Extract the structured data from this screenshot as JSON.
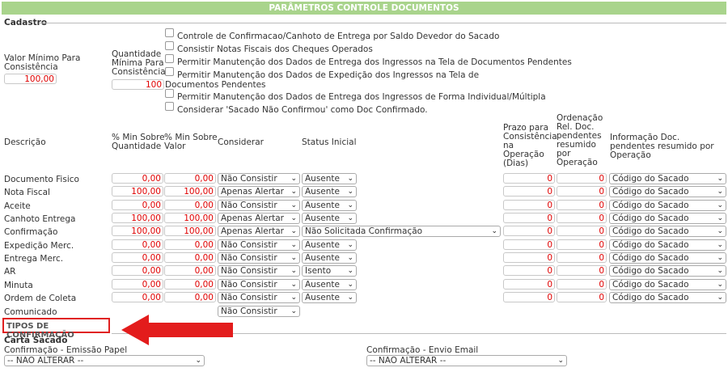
{
  "header": {
    "title": "PARÂMETROS CONTROLE DOCUMENTOS"
  },
  "cadastro": {
    "section_label": "Cadastro",
    "valor_min_label": "Valor Mínimo Para Consistência",
    "valor_min_value": "100,00",
    "qtd_min_label": "Quantidade Mínima Para Consistência",
    "qtd_min_value": "100",
    "checkboxes": [
      "Controle de Confirmacao/Canhoto de Entrega por Saldo Devedor do Sacado",
      "Consistir Notas Fiscais dos Cheques Operados",
      "Permitir Manutenção dos Dados de Entrega dos Ingressos na Tela de Documentos Pendentes",
      "Permitir Manutenção dos Dados de Expedição dos Ingressos na Tela de Documentos Pendentes",
      "Permitir Manutenção dos Dados de Entrega dos Ingressos de Forma Individual/Múltipla",
      "Considerar 'Sacado Não Confirmou' como Doc Confirmado."
    ]
  },
  "table": {
    "headers": {
      "descricao": "Descrição",
      "pct_qtd": "% Min Sobre Quantidade",
      "pct_valor": "% Min Sobre Valor",
      "considerar": "Considerar",
      "status": "Status Inicial",
      "prazo": "Prazo para Consistência na Operação (Dias)",
      "ordenacao": "Ordenação Rel. Doc. pendentes resumido por Operação",
      "info": "Informação Doc. pendentes resumido por Operação"
    },
    "rows": [
      {
        "desc": "Documento Fisico",
        "pct_qtd": "0,00",
        "pct_valor": "0,00",
        "considerar": "Não Consistir",
        "status": "Ausente",
        "prazo": "0",
        "ordenacao": "0",
        "info": "Código do Sacado"
      },
      {
        "desc": "Nota Fiscal",
        "pct_qtd": "100,00",
        "pct_valor": "100,00",
        "considerar": "Apenas Alertar",
        "status": "Ausente",
        "prazo": "0",
        "ordenacao": "0",
        "info": "Código do Sacado"
      },
      {
        "desc": "Aceite",
        "pct_qtd": "0,00",
        "pct_valor": "0,00",
        "considerar": "Não Consistir",
        "status": "Ausente",
        "prazo": "0",
        "ordenacao": "0",
        "info": "Código do Sacado"
      },
      {
        "desc": "Canhoto Entrega",
        "pct_qtd": "100,00",
        "pct_valor": "100,00",
        "considerar": "Apenas Alertar",
        "status": "Ausente",
        "prazo": "0",
        "ordenacao": "0",
        "info": "Código do Sacado"
      },
      {
        "desc": "Confirmação",
        "pct_qtd": "100,00",
        "pct_valor": "100,00",
        "considerar": "Apenas Alertar",
        "status": "Não Solicitada Confirmação",
        "prazo": "0",
        "ordenacao": "0",
        "info": "Código do Sacado"
      },
      {
        "desc": "Expedição Merc.",
        "pct_qtd": "0,00",
        "pct_valor": "0,00",
        "considerar": "Não Consistir",
        "status": "Ausente",
        "prazo": "0",
        "ordenacao": "0",
        "info": "Código do Sacado"
      },
      {
        "desc": "Entrega Merc.",
        "pct_qtd": "0,00",
        "pct_valor": "0,00",
        "considerar": "Não Consistir",
        "status": "Ausente",
        "prazo": "0",
        "ordenacao": "0",
        "info": "Código do Sacado"
      },
      {
        "desc": "AR",
        "pct_qtd": "0,00",
        "pct_valor": "0,00",
        "considerar": "Não Consistir",
        "status": "Isento",
        "prazo": "0",
        "ordenacao": "0",
        "info": "Código do Sacado"
      },
      {
        "desc": "Minuta",
        "pct_qtd": "0,00",
        "pct_valor": "0,00",
        "considerar": "Não Consistir",
        "status": "Ausente",
        "prazo": "0",
        "ordenacao": "0",
        "info": "Código do Sacado"
      },
      {
        "desc": "Ordem de Coleta",
        "pct_qtd": "0,00",
        "pct_valor": "0,00",
        "considerar": "Não Consistir",
        "status": "Ausente",
        "prazo": "0",
        "ordenacao": "0",
        "info": "Código do Sacado"
      },
      {
        "desc": "Comunicado",
        "considerar": "Não Consistir"
      }
    ]
  },
  "tipos": {
    "section_label": "TIPOS DE CONFIRMAÇÃO",
    "carta_sacado": "Carta Sacado",
    "emissao_label": "Confirmação - Emissão Papel",
    "emissao_value": "-- NÃO ALTERAR --",
    "email_label": "Confirmação - Envio Email",
    "email_value": "-- NÃO ALTERAR --"
  },
  "colors": {
    "header_bg": "#a9d48c",
    "value_red": "#e00000",
    "highlight_red": "#e02020"
  }
}
